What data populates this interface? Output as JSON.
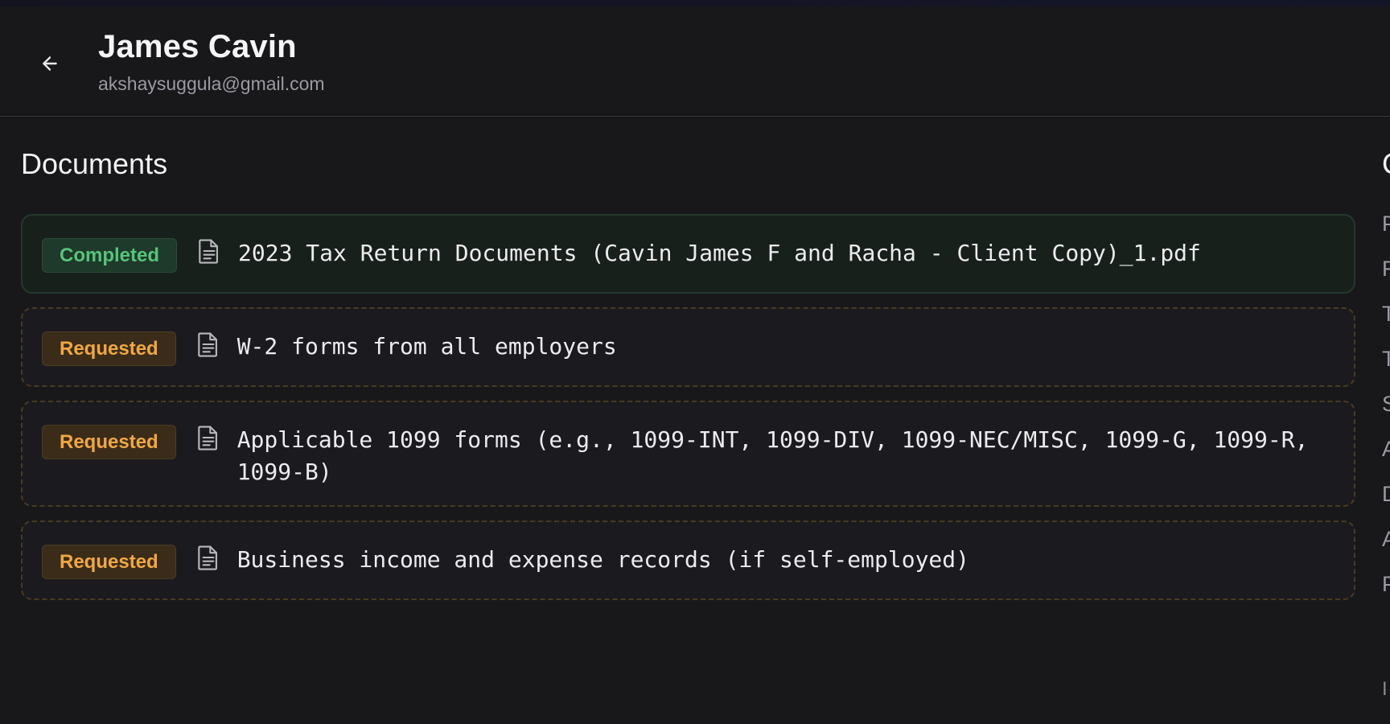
{
  "header": {
    "name": "James Cavin",
    "email": "akshaysuggula@gmail.com"
  },
  "documents": {
    "title": "Documents",
    "items": [
      {
        "status": "Completed",
        "title": "2023 Tax Return Documents (Cavin James F and Racha - Client Copy)_1.pdf"
      },
      {
        "status": "Requested",
        "title": "W-2 forms from all employers"
      },
      {
        "status": "Requested",
        "title": "Applicable 1099 forms (e.g., 1099-INT, 1099-DIV, 1099-NEC/MISC, 1099-G, 1099-R, 1099-B)"
      },
      {
        "status": "Requested",
        "title": "Business income and expense records (if self-employed)"
      }
    ]
  },
  "right_panel": {
    "title_fragment": "C",
    "item_initials": [
      "P",
      "F",
      "T",
      "T",
      "S",
      "A",
      "D",
      "A",
      "P"
    ],
    "footer_fragment": "I"
  },
  "colors": {
    "completed": "#56c47a",
    "requested": "#f0a840",
    "background": "#18181b"
  },
  "icons": {
    "back": "arrow-left-icon",
    "document": "file-text-icon"
  }
}
